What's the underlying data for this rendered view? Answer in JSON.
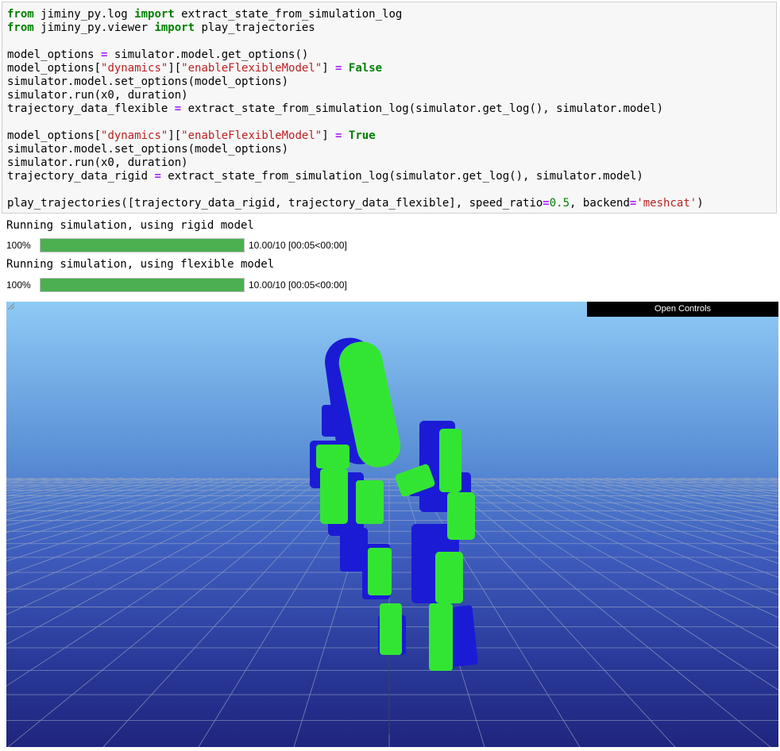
{
  "code_lines": [
    [
      {
        "t": "from",
        "c": "kw"
      },
      {
        "t": " jiminy_py.log "
      },
      {
        "t": "import",
        "c": "kw"
      },
      {
        "t": " extract_state_from_simulation_log"
      }
    ],
    [
      {
        "t": "from",
        "c": "kw"
      },
      {
        "t": " jiminy_py.viewer "
      },
      {
        "t": "import",
        "c": "kw"
      },
      {
        "t": " play_trajectories"
      }
    ],
    [],
    [
      {
        "t": "model_options "
      },
      {
        "t": "=",
        "c": "op"
      },
      {
        "t": " simulator.model.get_options()"
      }
    ],
    [
      {
        "t": "model_options["
      },
      {
        "t": "\"dynamics\"",
        "c": "str"
      },
      {
        "t": "]["
      },
      {
        "t": "\"enableFlexibleModel\"",
        "c": "str"
      },
      {
        "t": "] "
      },
      {
        "t": "=",
        "c": "op"
      },
      {
        "t": " "
      },
      {
        "t": "False",
        "c": "kw"
      }
    ],
    [
      {
        "t": "simulator.model.set_options(model_options)"
      }
    ],
    [
      {
        "t": "simulator.run(x0, duration)"
      }
    ],
    [
      {
        "t": "trajectory_data_flexible "
      },
      {
        "t": "=",
        "c": "op"
      },
      {
        "t": " extract_state_from_simulation_log(simulator.get_log(), simulator.model)"
      }
    ],
    [],
    [
      {
        "t": "model_options["
      },
      {
        "t": "\"dynamics\"",
        "c": "str"
      },
      {
        "t": "]["
      },
      {
        "t": "\"enableFlexibleModel\"",
        "c": "str"
      },
      {
        "t": "] "
      },
      {
        "t": "=",
        "c": "op"
      },
      {
        "t": " "
      },
      {
        "t": "True",
        "c": "kw"
      }
    ],
    [
      {
        "t": "simulator.model.set_options(model_options)"
      }
    ],
    [
      {
        "t": "simulator.run(x0, duration)"
      }
    ],
    [
      {
        "t": "trajectory_data_rigid "
      },
      {
        "t": "=",
        "c": "op"
      },
      {
        "t": " extract_state_from_simulation_log(simulator.get_log(), simulator.model)"
      }
    ],
    [],
    [
      {
        "t": "play_trajectories([trajectory_data_rigid, trajectory_data_flexible], speed_ratio"
      },
      {
        "t": "=",
        "c": "op"
      },
      {
        "t": "0.5",
        "c": "num"
      },
      {
        "t": ", backend"
      },
      {
        "t": "=",
        "c": "op"
      },
      {
        "t": "'meshcat'",
        "c": "str"
      },
      {
        "t": ")"
      }
    ]
  ],
  "output": {
    "rigid_message": "Running simulation, using rigid model",
    "flexible_message": "Running simulation, using flexible model",
    "progress_rigid": {
      "percent_label": "100%",
      "fraction": 1.0,
      "info": "10.00/10 [00:05<00:00]"
    },
    "progress_flexible": {
      "percent_label": "100%",
      "fraction": 1.0,
      "info": "10.00/10 [00:05<00:00]"
    }
  },
  "viewer": {
    "open_controls_label": "Open Controls",
    "robot_colors": {
      "rigid": "#1b1bd6",
      "flexible": "#33e533"
    }
  },
  "icons": {
    "resize": "resize-grip-icon"
  }
}
